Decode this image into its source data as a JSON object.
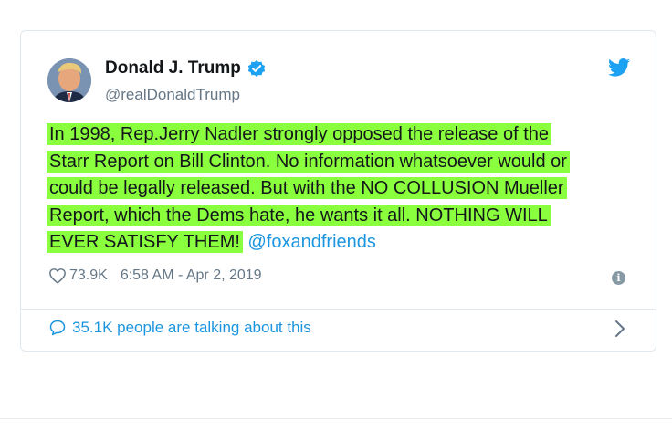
{
  "tweet": {
    "author_name": "Donald J. Trump",
    "handle": "@realDonaldTrump",
    "text_lines": [
      "In 1998, Rep.Jerry Nadler strongly opposed the release of the",
      "Starr Report on Bill Clinton. No information whatsoever would or",
      "could be legally released. But with the NO COLLUSION Mueller",
      "Report, which the Dems hate, he wants it all. NOTHING WILL",
      "EVER SATISFY THEM!"
    ],
    "mention": "@foxandfriends",
    "likes": "73.9K",
    "timestamp": "6:58 AM - Apr 2, 2019",
    "conversation": "35.1K people are talking about this"
  },
  "colors": {
    "highlight": "#8aff3e",
    "link": "#1b95e0",
    "secondary_text": "#657786",
    "verified_badge": "#1da1f2"
  },
  "icons": {
    "verified": "verified-badge-icon",
    "twitter": "twitter-bird-icon",
    "like": "heart-icon",
    "info": "info-icon",
    "reply": "speech-bubble-icon",
    "next": "chevron-right-icon"
  }
}
